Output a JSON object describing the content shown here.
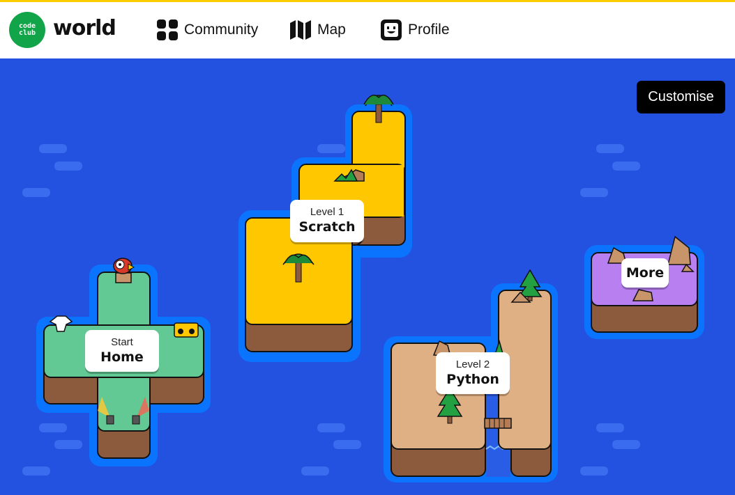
{
  "colors": {
    "accent_yellow": "#ffcc00",
    "logo_green": "#12a448",
    "ocean": "#2352e0",
    "shore": "#0a74ff",
    "home_island": "#63c994",
    "scratch_island": "#ffc700",
    "python_island": "#e0b085",
    "more_island": "#b77ff0",
    "cliff": "#8c5a3c",
    "customise_bg": "#000000"
  },
  "header": {
    "logo_text_top": "code",
    "logo_text_bottom": "club",
    "brand": "world",
    "nav": [
      {
        "label": "Community",
        "icon": "grid-icon"
      },
      {
        "label": "Map",
        "icon": "map-icon"
      },
      {
        "label": "Profile",
        "icon": "face-icon"
      }
    ]
  },
  "map": {
    "customise_label": "Customise",
    "islands": [
      {
        "id": "home",
        "small": "Start",
        "big": "Home"
      },
      {
        "id": "scratch",
        "small": "Level 1",
        "big": "Scratch"
      },
      {
        "id": "python",
        "small": "Level 2",
        "big": "Python"
      },
      {
        "id": "more",
        "small": "",
        "big": "More"
      }
    ]
  }
}
